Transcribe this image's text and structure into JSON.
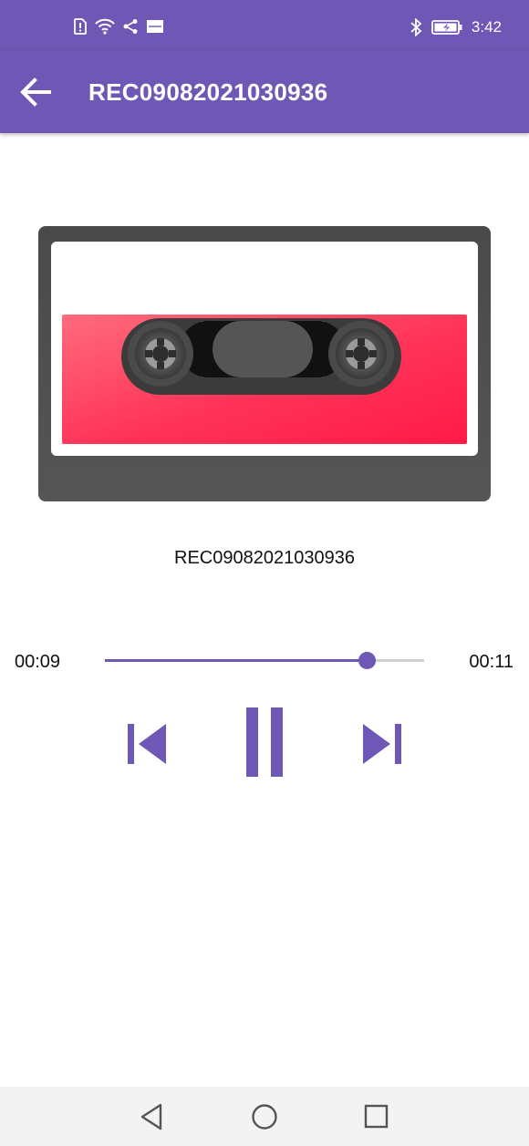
{
  "status_bar": {
    "time": "3:42",
    "left_icons": [
      "sim-alert-icon",
      "wifi-icon",
      "share-icon",
      "app-notification-icon"
    ],
    "right_icons": [
      "bluetooth-icon",
      "battery-icon"
    ]
  },
  "app_bar": {
    "title": "REC09082021030936",
    "back_icon": "arrow-left-icon"
  },
  "player": {
    "track_name": "REC09082021030936",
    "current_time": "00:09",
    "total_time": "00:11",
    "progress": 0.82,
    "accent_color": "#6f57b5",
    "controls": [
      "skip-previous-icon",
      "pause-icon",
      "skip-next-icon"
    ]
  },
  "nav_bar": {
    "buttons": [
      "back-triangle-icon",
      "home-circle-icon",
      "recents-square-icon"
    ]
  }
}
